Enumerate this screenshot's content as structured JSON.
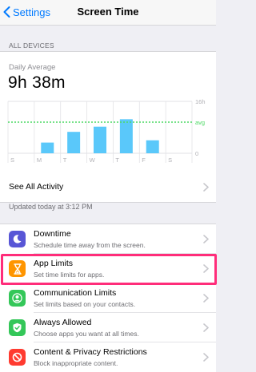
{
  "nav": {
    "back_label": "Settings",
    "title": "Screen Time"
  },
  "section_header": "ALL DEVICES",
  "summary": {
    "label": "Daily Average",
    "value": "9h 38m"
  },
  "chart_data": {
    "type": "bar",
    "categories": [
      "S",
      "M",
      "T",
      "W",
      "T",
      "F",
      "S"
    ],
    "values": [
      0,
      3.3,
      6.6,
      8.2,
      10.5,
      4.0,
      0
    ],
    "ylim": [
      0,
      16
    ],
    "y_tick_labels": [
      "16h",
      "0"
    ],
    "average": 9.6,
    "average_label": "avg",
    "bar_color": "#5ac8fa",
    "avg_color": "#4cd964",
    "grid": true
  },
  "see_all": "See All Activity",
  "updated": "Updated today at 3:12 PM",
  "items": [
    {
      "title": "Downtime",
      "subtitle": "Schedule time away from the screen.",
      "icon": "moon-icon",
      "color": "#5856d6"
    },
    {
      "title": "App Limits",
      "subtitle": "Set time limits for apps.",
      "icon": "hourglass-icon",
      "color": "#ff9500"
    },
    {
      "title": "Communication Limits",
      "subtitle": "Set limits based on your contacts.",
      "icon": "contact-icon",
      "color": "#34c759"
    },
    {
      "title": "Always Allowed",
      "subtitle": "Choose apps you want at all times.",
      "icon": "checkmark-icon",
      "color": "#34c759"
    },
    {
      "title": "Content & Privacy Restrictions",
      "subtitle": "Block inappropriate content.",
      "icon": "restricted-icon",
      "color": "#ff3b30"
    }
  ],
  "highlight_color": "#ff2d7a"
}
